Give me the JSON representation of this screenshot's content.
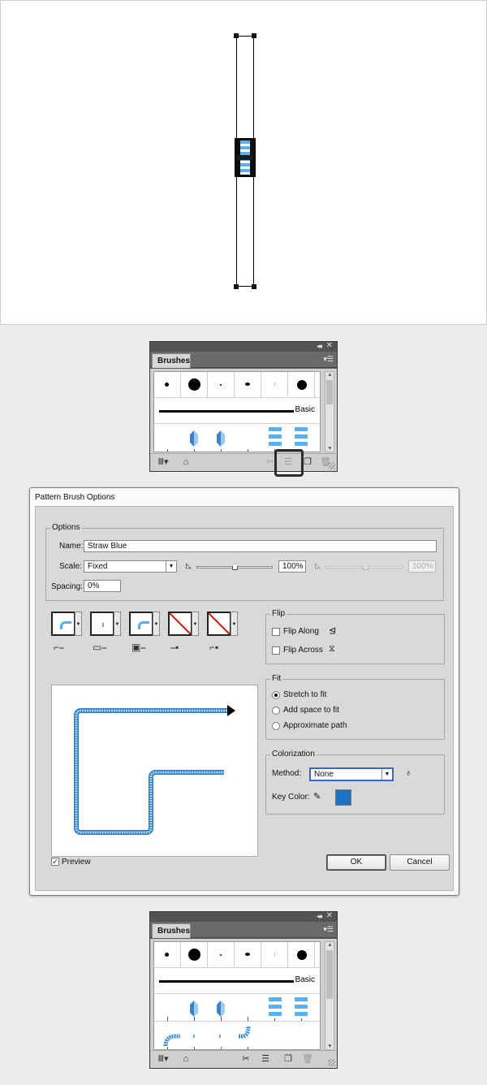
{
  "brushes_panel": {
    "tab": "Brushes",
    "basic_label": "Basic",
    "collapse_icon": "double-chevron-left",
    "close_icon": "x",
    "menu_icon": "panel-menu",
    "footer_icons": [
      "brush-libraries-menu",
      "libraries-panel",
      "remove-brush-stroke",
      "brush-options",
      "new-brush",
      "delete-brush"
    ]
  },
  "dialog": {
    "title": "Pattern Brush Options",
    "options_group": "Options",
    "name_label": "Name:",
    "name_value": "Straw Blue",
    "scale_label": "Scale:",
    "scale_value": "Fixed",
    "scale_percent": "100%",
    "scale_percent_max": "100%",
    "spacing_label": "Spacing:",
    "spacing_value": "0%",
    "flip_group": "Flip",
    "flip_along": "Flip Along",
    "flip_across": "Flip Across",
    "fit_group": "Fit",
    "fit_options": [
      "Stretch to fit",
      "Add space to fit",
      "Approximate path"
    ],
    "fit_selected": 0,
    "colorization_group": "Colorization",
    "method_label": "Method:",
    "method_value": "None",
    "key_color_label": "Key Color:",
    "key_color": "#1a73c4",
    "preview_label": "Preview",
    "preview_checked": true,
    "ok_label": "OK",
    "cancel_label": "Cancel",
    "check_mark": "✓"
  },
  "colors": {
    "straw_blue": "#5ab0f0",
    "straw_dark": "#2f79bf",
    "highlight_border": "#2b2b2b"
  }
}
